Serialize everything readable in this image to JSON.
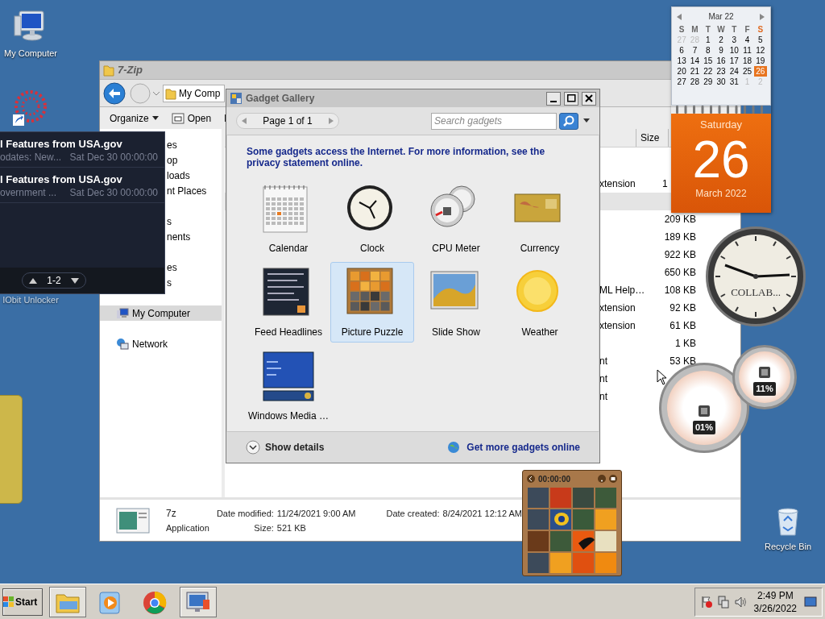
{
  "desktop_icons": [
    {
      "label": "My Computer",
      "kind": "computer"
    },
    {
      "label": "IObit Unlocker",
      "kind": "unlocker"
    },
    {
      "label": "Recycle Bin",
      "kind": "recycle"
    }
  ],
  "explorer": {
    "title": "7-Zip",
    "address": "My Comp",
    "toolbar": [
      "Organize",
      "Open",
      "I"
    ],
    "nav_groups": [
      [
        {
          "label": "es",
          "selected": false
        },
        {
          "label": "op",
          "selected": false
        },
        {
          "label": "loads",
          "selected": false
        },
        {
          "label": "nt Places",
          "selected": false
        }
      ],
      [
        {
          "label": "s",
          "selected": false
        },
        {
          "label": "nents",
          "selected": false
        }
      ],
      [
        {
          "label": "es",
          "selected": false
        },
        {
          "label": "s",
          "selected": false
        }
      ],
      [
        {
          "label": "My Computer",
          "selected": true,
          "kind": "computer"
        }
      ],
      [
        {
          "label": "Network",
          "selected": false,
          "kind": "network"
        }
      ]
    ],
    "columns": [
      "Size"
    ],
    "rows": [
      {
        "kind": "cut-file",
        "type": "xtension",
        "size": "1"
      },
      {
        "kind": "group"
      },
      {
        "kind": "file",
        "size": "209 KB"
      },
      {
        "kind": "file",
        "size": "189 KB"
      },
      {
        "kind": "file",
        "size": "922 KB"
      },
      {
        "kind": "file",
        "size": "650 KB"
      },
      {
        "kind": "file",
        "type": "ML Help…",
        "size": "108 KB"
      },
      {
        "kind": "file",
        "type": "xtension",
        "size": "92 KB"
      },
      {
        "kind": "file",
        "type": "xtension",
        "size": "61 KB"
      },
      {
        "kind": "file",
        "size": "1 KB"
      },
      {
        "kind": "file",
        "type": "nt",
        "size": "53 KB"
      },
      {
        "kind": "file",
        "type": "nt"
      },
      {
        "kind": "file",
        "type": "nt"
      }
    ],
    "details": {
      "name": "7z",
      "type": "Application",
      "modified_label": "Date modified:",
      "modified": "11/24/2021 9:00 AM",
      "size_label": "Size:",
      "size": "521 KB",
      "created_label": "Date created:",
      "created": "8/24/2021 12:12 AM"
    }
  },
  "gadget_gallery": {
    "title": "Gadget Gallery",
    "page": "Page 1 of 1",
    "search": {
      "placeholder": "Search gadgets"
    },
    "notice": "Some gadgets access the Internet.  For more information, see the privacy statement online.",
    "gadgets": [
      {
        "label": "Calendar",
        "kind": "calendar",
        "selected": false
      },
      {
        "label": "Clock",
        "kind": "clock",
        "selected": false
      },
      {
        "label": "CPU Meter",
        "kind": "meter",
        "selected": false
      },
      {
        "label": "Currency",
        "kind": "currency",
        "selected": false
      },
      {
        "label": "Feed Headlines",
        "kind": "feed",
        "selected": false
      },
      {
        "label": "Picture Puzzle",
        "kind": "puzzle",
        "selected": true
      },
      {
        "label": "Slide Show",
        "kind": "slides",
        "selected": false
      },
      {
        "label": "Weather",
        "kind": "weather",
        "selected": false
      },
      {
        "label": "Windows Media …",
        "kind": "media",
        "selected": false
      }
    ],
    "show_details": "Show details",
    "more_link": "Get more gadgets online"
  },
  "feed_gadget": {
    "items": [
      {
        "title": "l Features from USA.gov",
        "summary": "odates: New...",
        "date": "Sat Dec 30 00:00:00"
      },
      {
        "title": "l Features from USA.gov",
        "summary": "overnment ...",
        "date": "Sat Dec 30 00:00:00"
      }
    ],
    "pager": "1-2"
  },
  "calendar_gadget": {
    "month": "Mar 22",
    "weekdays": [
      "S",
      "M",
      "T",
      "W",
      "T",
      "F",
      "S"
    ],
    "days": [
      {
        "label": "27",
        "outside": true,
        "selected": false
      },
      {
        "label": "28",
        "outside": true,
        "selected": false
      },
      {
        "label": "1",
        "outside": false,
        "selected": false
      },
      {
        "label": "2",
        "outside": false,
        "selected": false
      },
      {
        "label": "3",
        "outside": false,
        "selected": false
      },
      {
        "label": "4",
        "outside": false,
        "selected": false
      },
      {
        "label": "5",
        "outside": false,
        "selected": false
      },
      {
        "label": "6",
        "outside": false,
        "selected": false
      },
      {
        "label": "7",
        "outside": false,
        "selected": false
      },
      {
        "label": "8",
        "outside": false,
        "selected": false
      },
      {
        "label": "9",
        "outside": false,
        "selected": false
      },
      {
        "label": "10",
        "outside": false,
        "selected": false
      },
      {
        "label": "11",
        "outside": false,
        "selected": false
      },
      {
        "label": "12",
        "outside": false,
        "selected": false
      },
      {
        "label": "13",
        "outside": false,
        "selected": false
      },
      {
        "label": "14",
        "outside": false,
        "selected": false
      },
      {
        "label": "15",
        "outside": false,
        "selected": false
      },
      {
        "label": "16",
        "outside": false,
        "selected": false
      },
      {
        "label": "17",
        "outside": false,
        "selected": false
      },
      {
        "label": "18",
        "outside": false,
        "selected": false
      },
      {
        "label": "19",
        "outside": false,
        "selected": false
      },
      {
        "label": "20",
        "outside": false,
        "selected": false
      },
      {
        "label": "21",
        "outside": false,
        "selected": false
      },
      {
        "label": "22",
        "outside": false,
        "selected": false
      },
      {
        "label": "23",
        "outside": false,
        "selected": false
      },
      {
        "label": "24",
        "outside": false,
        "selected": false
      },
      {
        "label": "25",
        "outside": false,
        "selected": false
      },
      {
        "label": "26",
        "outside": false,
        "selected": true
      },
      {
        "label": "27",
        "outside": false,
        "selected": false
      },
      {
        "label": "28",
        "outside": false,
        "selected": false
      },
      {
        "label": "29",
        "outside": false,
        "selected": false
      },
      {
        "label": "30",
        "outside": false,
        "selected": false
      },
      {
        "label": "31",
        "outside": false,
        "selected": false
      },
      {
        "label": "1",
        "outside": true,
        "selected": false
      },
      {
        "label": "2",
        "outside": true,
        "selected": false
      }
    ],
    "weekday": "Saturday",
    "day": "26",
    "month_year": "March 2022"
  },
  "clock_gadget": {
    "label": "COLLAB..."
  },
  "cpu_gadget": {
    "readings": [
      "01%",
      "11%"
    ]
  },
  "puzzle_gadget": {
    "timer": "00:00:00"
  },
  "taskbar": {
    "start": "Start",
    "apps": [
      {
        "kind": "folder",
        "selected": true
      },
      {
        "kind": "media",
        "selected": false
      },
      {
        "kind": "browser",
        "selected": false
      },
      {
        "kind": "monitor",
        "selected": true
      }
    ],
    "time": "2:49 PM",
    "date": "3/26/2022"
  }
}
